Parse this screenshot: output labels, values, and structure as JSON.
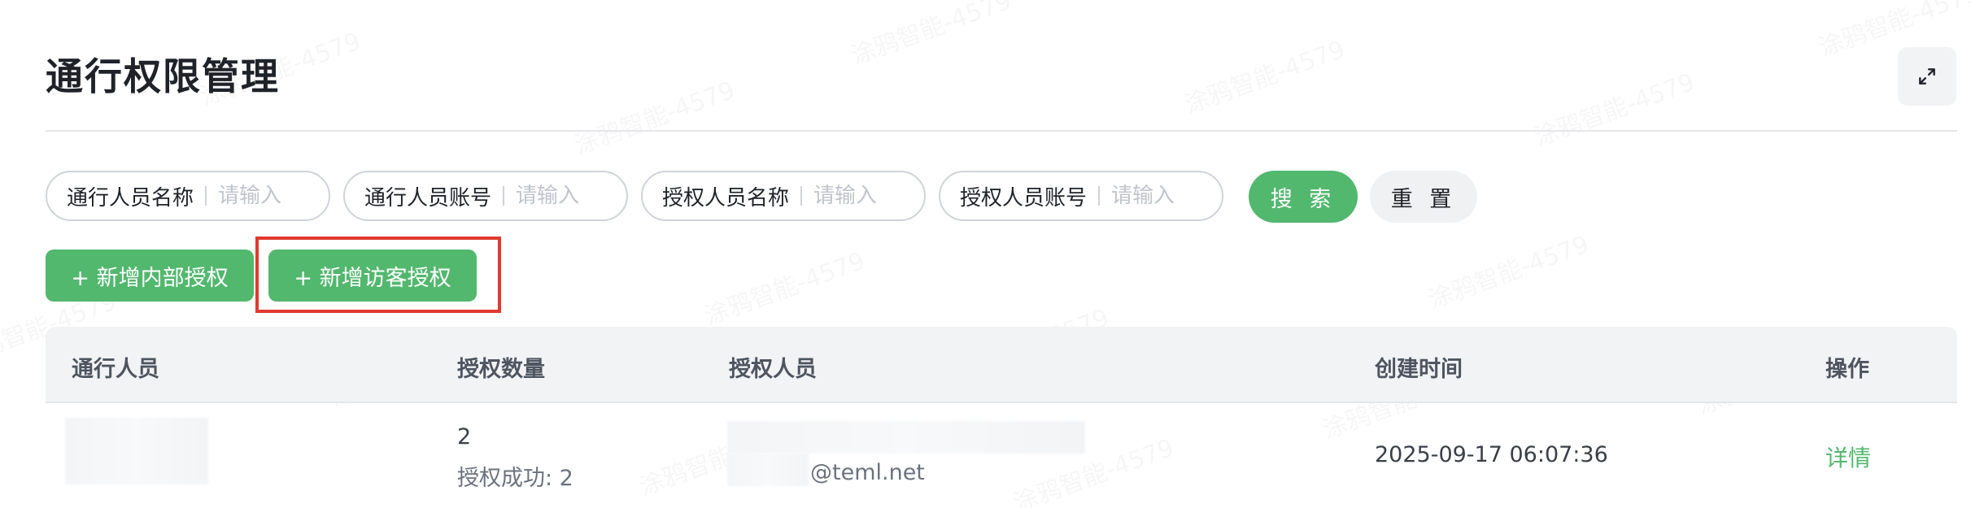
{
  "page": {
    "title": "通行权限管理",
    "watermark": "涂鸦智能-4579"
  },
  "header": {
    "expand_icon": "expand-arrows-icon"
  },
  "filters": [
    {
      "label": "通行人员名称",
      "placeholder": "请输入",
      "value": ""
    },
    {
      "label": "通行人员账号",
      "placeholder": "请输入",
      "value": ""
    },
    {
      "label": "授权人员名称",
      "placeholder": "请输入",
      "value": ""
    },
    {
      "label": "授权人员账号",
      "placeholder": "请输入",
      "value": ""
    }
  ],
  "actions": {
    "search_label": "搜 索",
    "reset_label": "重 置",
    "add_internal_label": "+ 新增内部授权",
    "add_visitor_label": "+ 新增访客授权"
  },
  "table": {
    "columns": [
      "通行人员",
      "授权数量",
      "授权人员",
      "创建时间",
      "操作"
    ],
    "rows": [
      {
        "person": "",
        "auth_count": "2",
        "auth_success": "授权成功: 2",
        "authorizer_email": "@teml.net",
        "created_at": "2025-09-17 06:07:36",
        "action": "详情"
      }
    ]
  },
  "colors": {
    "accent": "#52b86e",
    "highlight": "#e03a2f",
    "header_bg": "#f2f3f5"
  }
}
